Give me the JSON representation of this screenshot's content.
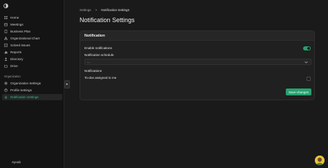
{
  "sidebar": {
    "nav": [
      {
        "label": "Home",
        "icon": "grid-icon"
      },
      {
        "label": "Meetings",
        "icon": "calendar-icon"
      },
      {
        "label": "Business Plan",
        "icon": "book-icon"
      },
      {
        "label": "Organizational Chart",
        "icon": "org-chart-icon"
      },
      {
        "label": "Solved Issues",
        "icon": "check-square-icon"
      },
      {
        "label": "Reports",
        "icon": "chart-icon"
      },
      {
        "label": "Directory",
        "icon": "user-icon"
      },
      {
        "label": "Drive",
        "icon": "folder-icon"
      }
    ],
    "org_section_label": "Organization",
    "org_nav": [
      {
        "label": "Organization Settings",
        "icon": "gear-icon"
      },
      {
        "label": "Profile Settings",
        "icon": "user-circle-icon"
      },
      {
        "label": "Notification Settings",
        "icon": "bell-icon"
      }
    ],
    "active_item": "Notification Settings",
    "user_name": "Ayoub"
  },
  "breadcrumb": {
    "parent": "Settings",
    "separator": ">",
    "current": "Notification Settings"
  },
  "page_title": "Notification Settings",
  "card": {
    "title": "Notification",
    "enable_label": "Enable notifications",
    "enable_on": true,
    "schedule_label": "Notification schedule",
    "schedule_value": "...",
    "notifications_label": "Notifications",
    "todo_label": "To-dos assigned to me",
    "todo_checked": false,
    "save_label": "Save changes"
  },
  "colors": {
    "accent": "#27a070",
    "background": "#1a1a1a",
    "sidebar": "#141414"
  }
}
